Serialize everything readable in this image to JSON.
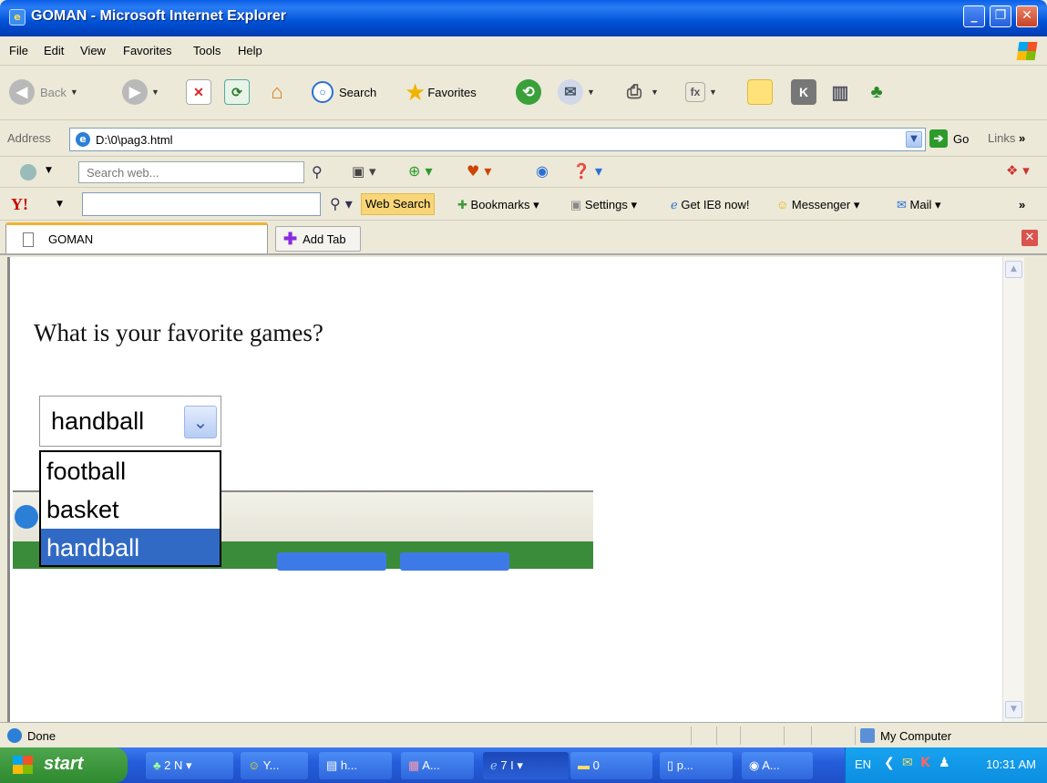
{
  "window": {
    "title": "GOMAN - Microsoft Internet Explorer"
  },
  "menu": [
    "File",
    "Edit",
    "View",
    "Favorites",
    "Tools",
    "Help"
  ],
  "toolbar": {
    "back": "Back",
    "search": "Search",
    "favorites": "Favorites"
  },
  "address": {
    "label": "Address",
    "value": "D:\\0\\pag3.html",
    "go": "Go",
    "links": "Links"
  },
  "search_toolbar": {
    "placeholder": "Search web..."
  },
  "yahoo_toolbar": {
    "web_search": "Web Search",
    "bookmarks": "Bookmarks",
    "settings": "Settings",
    "get_ie8": "Get IE8 now!",
    "messenger": "Messenger",
    "mail": "Mail"
  },
  "tabs": {
    "active": "GOMAN",
    "add": "Add Tab"
  },
  "page": {
    "question": "What is your favorite games?",
    "select_value": "handball",
    "options": [
      "football",
      "basket",
      "handball"
    ],
    "selected_option_index": 2
  },
  "status": {
    "left": "Done",
    "zone": "My Computer"
  },
  "taskbar": {
    "start": "start",
    "tasks": [
      "2 N",
      "Y...",
      "h...",
      "A...",
      "7 I",
      "0",
      "p...",
      "A..."
    ],
    "language": "EN",
    "clock": "10:31 AM"
  },
  "colors": {
    "selection": "#316ac5",
    "titlebar": "#0052d6",
    "taskbar": "#245edb"
  }
}
